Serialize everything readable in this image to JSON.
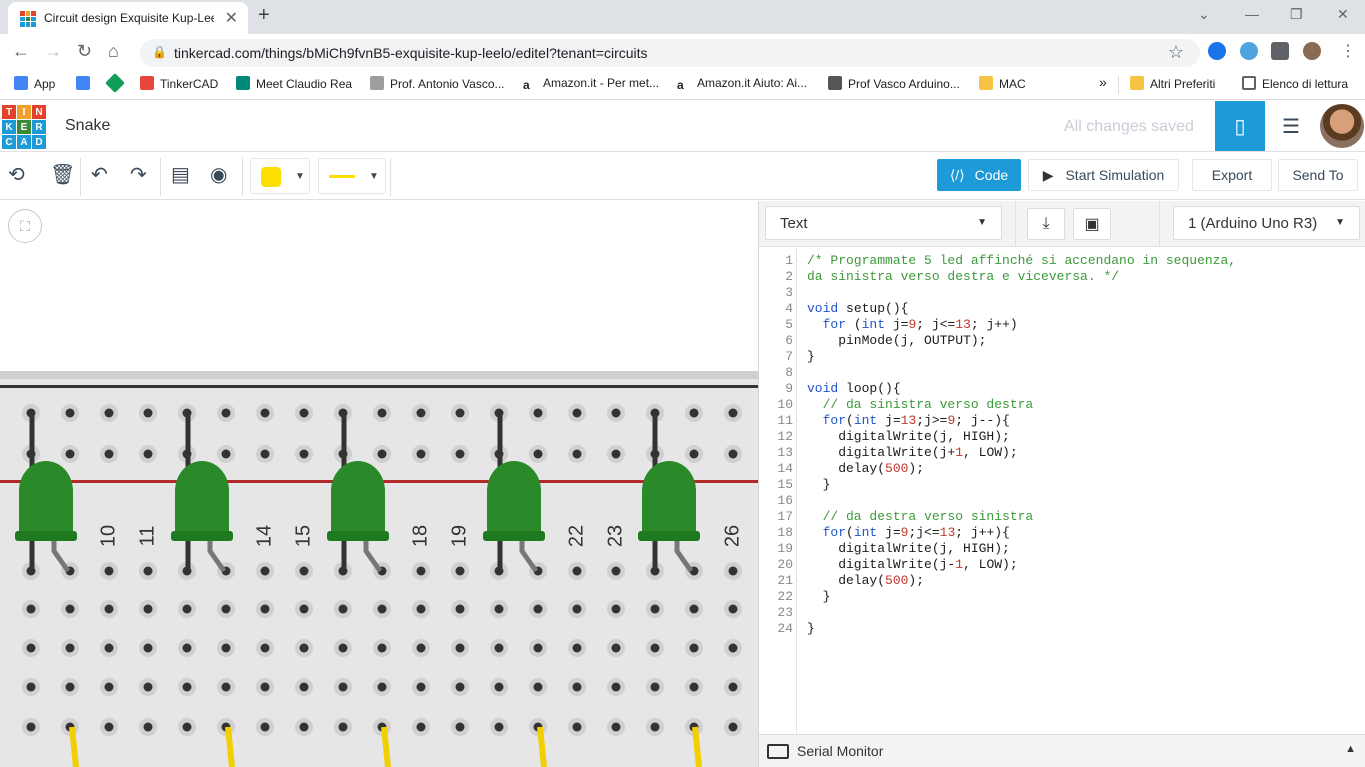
{
  "browser": {
    "tab_title": "Circuit design Exquisite Kup-Leelo",
    "tab_close": "✕",
    "new_tab": "+",
    "url": "tinkercad.com/things/bMiCh9fvnB5-exquisite-kup-leelo/editel?tenant=circuits",
    "bookmarks": [
      {
        "label": "App",
        "color": "#4285f4"
      },
      {
        "label": "",
        "color": "#4285f4"
      },
      {
        "label": "",
        "color": "#0f9d58"
      },
      {
        "label": "TinkerCAD",
        "color": "#e8453c"
      },
      {
        "label": "Meet Claudio Rea",
        "color": "#00897b"
      },
      {
        "label": "Prof. Antonio Vasco...",
        "color": "#9e9e9e"
      },
      {
        "label": "Amazon.it - Per met...",
        "color": "#222222"
      },
      {
        "label": "Amazon.it Aiuto: Ai...",
        "color": "#222222"
      },
      {
        "label": "Prof Vasco Arduino...",
        "color": "#555555"
      },
      {
        "label": "MAC",
        "color": "#f6c343"
      }
    ],
    "bookmarks_more": "»",
    "other_bookmarks": "Altri Preferiti",
    "reading_list": "Elenco di lettura"
  },
  "app": {
    "logo_letters": [
      "T",
      "I",
      "N",
      "K",
      "E",
      "R",
      "C",
      "A",
      "D"
    ],
    "logo_colors": [
      "#e2412a",
      "#f0a02a",
      "#e2412a",
      "#1d9bd8",
      "#3a8a3a",
      "#1d9bd8",
      "#1d9bd8",
      "#1d9bd8",
      "#1d9bd8"
    ],
    "project_name": "Snake",
    "save_status": "All changes saved"
  },
  "toolbar": {
    "code_label": "Code",
    "simulate_label": "Start Simulation",
    "export_label": "Export",
    "sendto_label": "Send To",
    "selected_color": "#fcdf00"
  },
  "breadboard": {
    "column_labels": [
      "10",
      "11",
      "14",
      "15",
      "18",
      "19",
      "22",
      "23",
      "26"
    ],
    "leds": 5,
    "led_color": "#2a8a2a",
    "rail_color": "#b22a2a",
    "wire_color": "#f0d000"
  },
  "code_panel": {
    "mode": "Text",
    "device": "1 (Arduino Uno R3)",
    "serial_monitor": "Serial Monitor",
    "lines": [
      "/* Programmate 5 led affinché si accendano in sequenza,",
      "da sinistra verso destra e viceversa. */",
      "",
      "void setup(){",
      "  for (int j=9; j<=13; j++)",
      "    pinMode(j, OUTPUT);",
      "}",
      "",
      "void loop(){",
      "  // da sinistra verso destra",
      "  for(int j=13;j>=9; j--){",
      "    digitalWrite(j, HIGH);",
      "    digitalWrite(j+1, LOW);",
      "    delay(500);",
      "  }",
      "",
      "  // da destra verso sinistra",
      "  for(int j=9;j<=13; j++){",
      "    digitalWrite(j, HIGH);",
      "    digitalWrite(j-1, LOW);",
      "    delay(500);",
      "  }",
      "",
      "}"
    ]
  }
}
